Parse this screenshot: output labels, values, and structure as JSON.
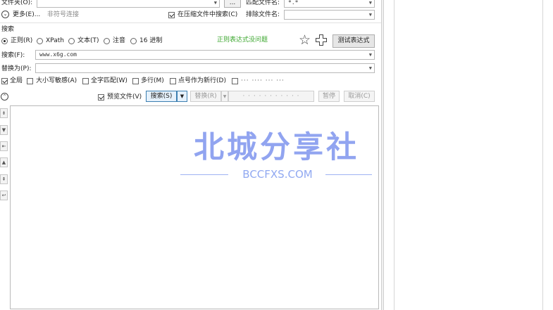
{
  "form": {
    "folder_label": "文件夹(O):",
    "folder_value": "",
    "browse_label": "...",
    "match_filename_label": "匹配文件名:",
    "match_filename_value": "*.*",
    "more_label": "更多(E)...",
    "non_symlink_label": "非符号连接",
    "search_in_archives_label": "在压缩文件中搜索(C)",
    "exclude_filename_label": "排除文件名:",
    "exclude_filename_value": ""
  },
  "search": {
    "section_label": "搜索",
    "modes": [
      {
        "label": "正则(R)",
        "selected": true
      },
      {
        "label": "XPath",
        "selected": false
      },
      {
        "label": "文本(T)",
        "selected": false
      },
      {
        "label": "注音",
        "selected": false
      },
      {
        "label": "16 进制",
        "selected": false
      }
    ],
    "regex_status": "正则表达式没问题",
    "regex_status_color": "#3aa62c",
    "test_regex_label": "测试表达式",
    "search_for_label": "搜索(F):",
    "search_for_value": "www.x6g.com",
    "replace_with_label": "替换为(P):",
    "replace_with_value": ""
  },
  "options": [
    {
      "label": "全局",
      "checked": true
    },
    {
      "label": "大小写敏感(A)",
      "checked": false
    },
    {
      "label": "全字匹配(W)",
      "checked": false
    },
    {
      "label": "多行(M)",
      "checked": false
    },
    {
      "label": "点号作为新行(D)",
      "checked": false
    },
    {
      "label": "···  ····  ···  ···",
      "checked": false
    }
  ],
  "actions": {
    "preview_label": "预览文件(V)",
    "search_label": "搜索(S)",
    "replace_label": "替换(R)",
    "blurred_label": "· · · · · · · · · · ·",
    "pause_label": "暂停",
    "cancel_label": "取消(C)"
  },
  "side_icons": [
    "collapse-all-icon",
    "expand-down-icon",
    "align-left-icon",
    "move-up-icon",
    "sort-icon",
    "return-icon"
  ],
  "watermark": {
    "title": "北城分享社",
    "subtitle": "BCCFXS.COM"
  }
}
